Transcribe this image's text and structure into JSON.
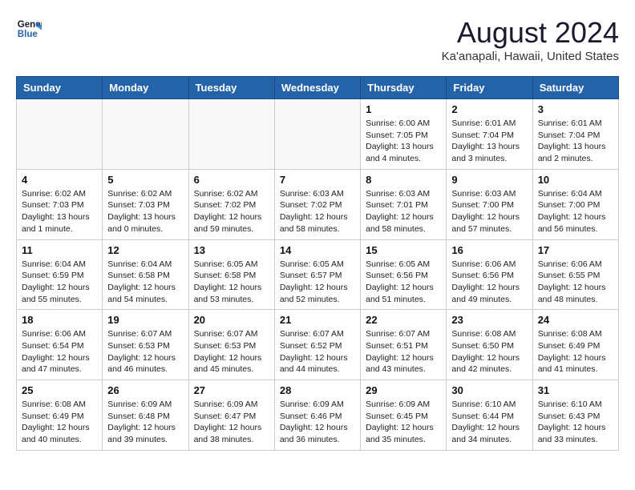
{
  "header": {
    "logo_line1": "General",
    "logo_line2": "Blue",
    "month_title": "August 2024",
    "location": "Ka'anapali, Hawaii, United States"
  },
  "weekdays": [
    "Sunday",
    "Monday",
    "Tuesday",
    "Wednesday",
    "Thursday",
    "Friday",
    "Saturday"
  ],
  "weeks": [
    [
      {
        "day": "",
        "info": ""
      },
      {
        "day": "",
        "info": ""
      },
      {
        "day": "",
        "info": ""
      },
      {
        "day": "",
        "info": ""
      },
      {
        "day": "1",
        "info": "Sunrise: 6:00 AM\nSunset: 7:05 PM\nDaylight: 13 hours\nand 4 minutes."
      },
      {
        "day": "2",
        "info": "Sunrise: 6:01 AM\nSunset: 7:04 PM\nDaylight: 13 hours\nand 3 minutes."
      },
      {
        "day": "3",
        "info": "Sunrise: 6:01 AM\nSunset: 7:04 PM\nDaylight: 13 hours\nand 2 minutes."
      }
    ],
    [
      {
        "day": "4",
        "info": "Sunrise: 6:02 AM\nSunset: 7:03 PM\nDaylight: 13 hours\nand 1 minute."
      },
      {
        "day": "5",
        "info": "Sunrise: 6:02 AM\nSunset: 7:03 PM\nDaylight: 13 hours\nand 0 minutes."
      },
      {
        "day": "6",
        "info": "Sunrise: 6:02 AM\nSunset: 7:02 PM\nDaylight: 12 hours\nand 59 minutes."
      },
      {
        "day": "7",
        "info": "Sunrise: 6:03 AM\nSunset: 7:02 PM\nDaylight: 12 hours\nand 58 minutes."
      },
      {
        "day": "8",
        "info": "Sunrise: 6:03 AM\nSunset: 7:01 PM\nDaylight: 12 hours\nand 58 minutes."
      },
      {
        "day": "9",
        "info": "Sunrise: 6:03 AM\nSunset: 7:00 PM\nDaylight: 12 hours\nand 57 minutes."
      },
      {
        "day": "10",
        "info": "Sunrise: 6:04 AM\nSunset: 7:00 PM\nDaylight: 12 hours\nand 56 minutes."
      }
    ],
    [
      {
        "day": "11",
        "info": "Sunrise: 6:04 AM\nSunset: 6:59 PM\nDaylight: 12 hours\nand 55 minutes."
      },
      {
        "day": "12",
        "info": "Sunrise: 6:04 AM\nSunset: 6:58 PM\nDaylight: 12 hours\nand 54 minutes."
      },
      {
        "day": "13",
        "info": "Sunrise: 6:05 AM\nSunset: 6:58 PM\nDaylight: 12 hours\nand 53 minutes."
      },
      {
        "day": "14",
        "info": "Sunrise: 6:05 AM\nSunset: 6:57 PM\nDaylight: 12 hours\nand 52 minutes."
      },
      {
        "day": "15",
        "info": "Sunrise: 6:05 AM\nSunset: 6:56 PM\nDaylight: 12 hours\nand 51 minutes."
      },
      {
        "day": "16",
        "info": "Sunrise: 6:06 AM\nSunset: 6:56 PM\nDaylight: 12 hours\nand 49 minutes."
      },
      {
        "day": "17",
        "info": "Sunrise: 6:06 AM\nSunset: 6:55 PM\nDaylight: 12 hours\nand 48 minutes."
      }
    ],
    [
      {
        "day": "18",
        "info": "Sunrise: 6:06 AM\nSunset: 6:54 PM\nDaylight: 12 hours\nand 47 minutes."
      },
      {
        "day": "19",
        "info": "Sunrise: 6:07 AM\nSunset: 6:53 PM\nDaylight: 12 hours\nand 46 minutes."
      },
      {
        "day": "20",
        "info": "Sunrise: 6:07 AM\nSunset: 6:53 PM\nDaylight: 12 hours\nand 45 minutes."
      },
      {
        "day": "21",
        "info": "Sunrise: 6:07 AM\nSunset: 6:52 PM\nDaylight: 12 hours\nand 44 minutes."
      },
      {
        "day": "22",
        "info": "Sunrise: 6:07 AM\nSunset: 6:51 PM\nDaylight: 12 hours\nand 43 minutes."
      },
      {
        "day": "23",
        "info": "Sunrise: 6:08 AM\nSunset: 6:50 PM\nDaylight: 12 hours\nand 42 minutes."
      },
      {
        "day": "24",
        "info": "Sunrise: 6:08 AM\nSunset: 6:49 PM\nDaylight: 12 hours\nand 41 minutes."
      }
    ],
    [
      {
        "day": "25",
        "info": "Sunrise: 6:08 AM\nSunset: 6:49 PM\nDaylight: 12 hours\nand 40 minutes."
      },
      {
        "day": "26",
        "info": "Sunrise: 6:09 AM\nSunset: 6:48 PM\nDaylight: 12 hours\nand 39 minutes."
      },
      {
        "day": "27",
        "info": "Sunrise: 6:09 AM\nSunset: 6:47 PM\nDaylight: 12 hours\nand 38 minutes."
      },
      {
        "day": "28",
        "info": "Sunrise: 6:09 AM\nSunset: 6:46 PM\nDaylight: 12 hours\nand 36 minutes."
      },
      {
        "day": "29",
        "info": "Sunrise: 6:09 AM\nSunset: 6:45 PM\nDaylight: 12 hours\nand 35 minutes."
      },
      {
        "day": "30",
        "info": "Sunrise: 6:10 AM\nSunset: 6:44 PM\nDaylight: 12 hours\nand 34 minutes."
      },
      {
        "day": "31",
        "info": "Sunrise: 6:10 AM\nSunset: 6:43 PM\nDaylight: 12 hours\nand 33 minutes."
      }
    ]
  ]
}
